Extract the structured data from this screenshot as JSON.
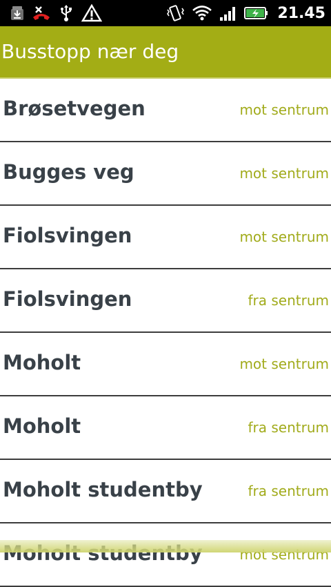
{
  "status_bar": {
    "time": "21.45",
    "icons": [
      "download-icon",
      "missed-call-icon",
      "usb-icon",
      "warning-icon",
      "vibrate-icon",
      "wifi-icon",
      "signal-icon",
      "battery-charging-icon"
    ]
  },
  "header": {
    "title": "Busstopp nær deg"
  },
  "stops": [
    {
      "name": "Brøsetvegen",
      "direction": "mot sentrum"
    },
    {
      "name": "Bugges veg",
      "direction": "mot sentrum"
    },
    {
      "name": "Fiolsvingen",
      "direction": "mot sentrum"
    },
    {
      "name": "Fiolsvingen",
      "direction": "fra sentrum"
    },
    {
      "name": "Moholt",
      "direction": "mot sentrum"
    },
    {
      "name": "Moholt",
      "direction": "fra sentrum"
    },
    {
      "name": "Moholt studentby",
      "direction": "fra sentrum"
    },
    {
      "name": "Moholt studentby",
      "direction": "mot sentrum"
    }
  ],
  "colors": {
    "accent": "#a3ad15",
    "direction_text": "#a1ab1b",
    "stop_text": "#394148",
    "divider": "#3c3c3c"
  }
}
